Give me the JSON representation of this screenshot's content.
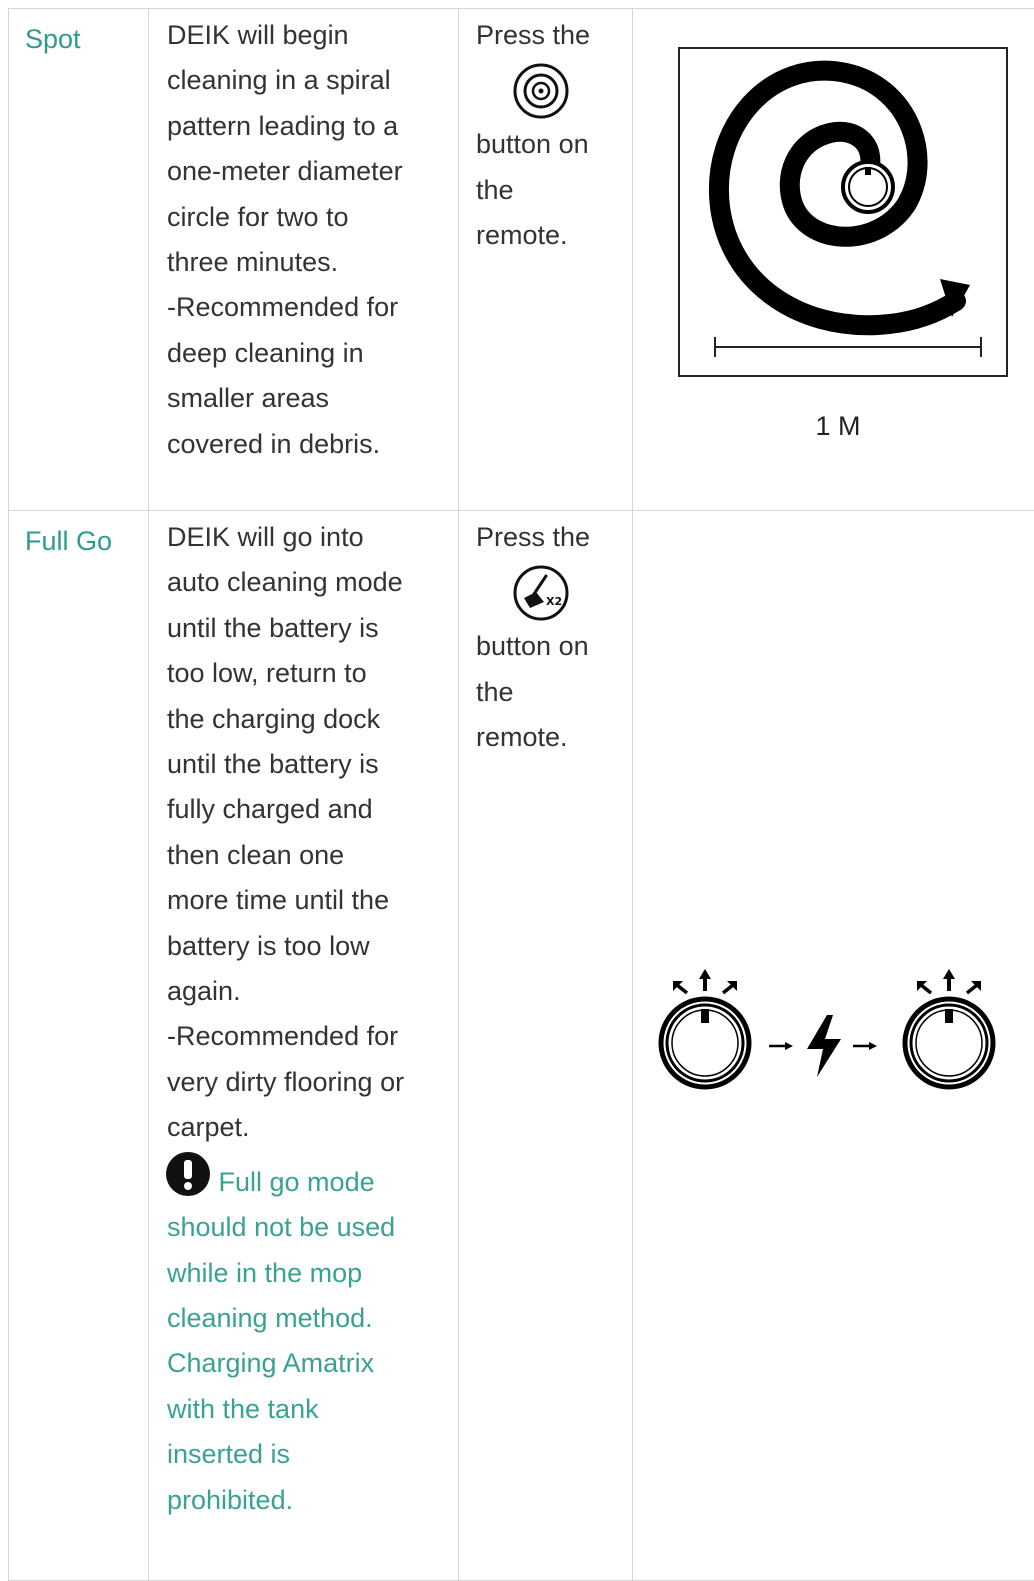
{
  "rows": [
    {
      "mode": "Spot",
      "description_lines": [
        "DEIK will begin",
        "cleaning in a spiral",
        "pattern leading to a",
        "one-meter diameter",
        "circle for two to",
        "three minutes.",
        "-Recommended for",
        "deep cleaning in",
        "smaller areas",
        "covered in debris."
      ],
      "press_before": "Press the",
      "press_after_lines": [
        "button on",
        "the",
        "remote."
      ],
      "button_icon": "spot-spiral-icon",
      "illustration": "spiral-cleaning-pattern",
      "scale_label": "1 M"
    },
    {
      "mode": "Full Go",
      "description_lines": [
        "DEIK will go into",
        "auto cleaning mode",
        "until the battery is",
        "too low, return to",
        "the charging dock",
        "until the battery is",
        "fully charged and",
        "then clean one",
        "more time until the",
        "battery is too low",
        "again.",
        "-Recommended for",
        "very dirty flooring or",
        "carpet."
      ],
      "warning_first": "Full go mode",
      "warning_lines": [
        "should not be used",
        "while in the mop",
        "cleaning method.",
        "Charging Amatrix",
        "with the tank",
        "inserted is",
        "prohibited."
      ],
      "press_before": "Press the",
      "press_after_lines": [
        "button on",
        "the",
        "remote."
      ],
      "button_icon": "full-go-x2-icon",
      "illustration": "robot-charge-robot-cycle"
    }
  ],
  "colors": {
    "mode_name": "#2f9a8e",
    "warning_text": "#3aa293",
    "body_text": "#333333",
    "border": "#d6d6d6"
  }
}
